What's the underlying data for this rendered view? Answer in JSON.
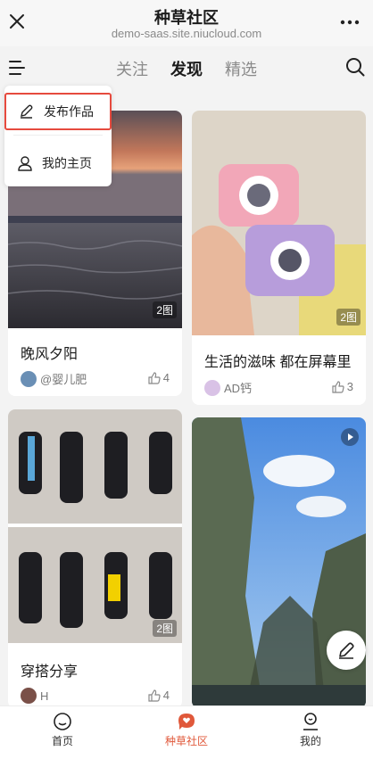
{
  "titlebar": {
    "title": "种草社区",
    "url": "demo-saas.site.niucloud.com"
  },
  "nav": {
    "tabs": [
      "关注",
      "发现",
      "精选"
    ],
    "active": "发现"
  },
  "menu": {
    "items": [
      "发布作品",
      "我的主页"
    ]
  },
  "cards": [
    {
      "title": "晚风夕阳",
      "author": "@婴儿肥",
      "likes": "4",
      "count": "2图"
    },
    {
      "title": "生活的滋味 都在屏幕里",
      "author": "AD钙",
      "likes": "3",
      "count": "2图"
    },
    {
      "title": "穿搭分享",
      "author": "H",
      "likes": "4",
      "count": "2图"
    }
  ],
  "bottom": {
    "items": [
      "首页",
      "种草社区",
      "我的"
    ]
  },
  "colors": {
    "accent": "#e0583a",
    "highlight": "#e64a3e"
  }
}
